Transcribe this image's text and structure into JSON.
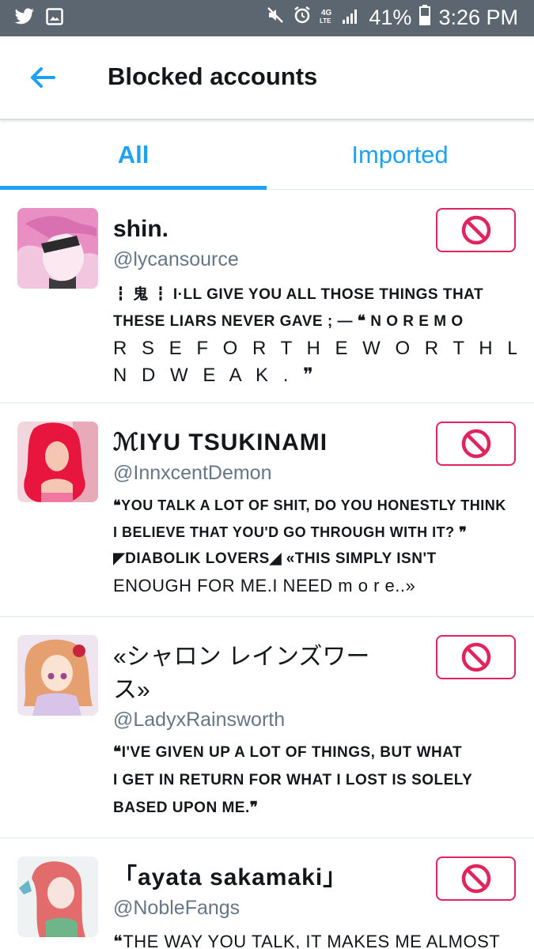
{
  "status_bar": {
    "battery": "41%",
    "time": "3:26 PM",
    "network": "4G LTE"
  },
  "header": {
    "title": "Blocked accounts"
  },
  "tabs": [
    {
      "label": "All",
      "active": true
    },
    {
      "label": "Imported",
      "active": false
    }
  ],
  "accounts": [
    {
      "name": "shin.",
      "handle": "@lycansource",
      "bio_lines": [
        "┇ 鬼 ┇ I·LL GIVE YOU ALL THOSE THINGS THAT",
        "THESE LIARS NEVER GAVE ; — ❝ N O R E M O",
        "R S E F O R T H E W O R T H L E S S A",
        "N D W E A K . ❞"
      ]
    },
    {
      "name": "ℳIYU TSUKINAMI",
      "handle": "@InnxcentDemon",
      "bio_lines": [
        "❝YOU TALK A LOT OF SHIT, DO YOU HONESTLY THINK",
        "I BELIEVE THAT YOU'D GO THROUGH WITH IT? ❞",
        "◤DIABOLIK LOVERS◢ «THIS SIMPLY ISN'T",
        "ENOUGH FOR ME.I NEED m o r e..»"
      ]
    },
    {
      "name": "«シャロン レインズワー ス»",
      "handle": "@LadyxRainsworth",
      "bio_lines": [
        "❝I'VE GIVEN UP A LOT OF THINGS, BUT WHAT",
        "I GET IN RETURN FOR WHAT I LOST IS SOLELY",
        "BASED UPON ME.❞"
      ]
    },
    {
      "name": "「ayata sakamaki」",
      "handle": "@NobleFangs",
      "bio_lines": [
        "❝THE WAY YOU TALK, IT MAKES ME ALMOST"
      ]
    }
  ],
  "colors": {
    "accent": "#1da1f2",
    "block": "#e0245e",
    "status_bar": "#5b6670"
  },
  "icons": {
    "back": "arrow-left-icon",
    "block": "block-icon"
  }
}
